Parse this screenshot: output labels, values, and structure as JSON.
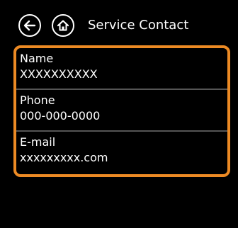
{
  "header": {
    "title": "Service Contact",
    "back_icon": "arrow-left-icon",
    "home_icon": "home-icon"
  },
  "contact": {
    "rows": [
      {
        "label": "Name",
        "value": "XXXXXXXXXX"
      },
      {
        "label": "Phone",
        "value": "000-000-0000"
      },
      {
        "label": "E-mail",
        "value": "xxxxxxxxx.com"
      }
    ]
  },
  "colors": {
    "accent": "#ec8a24",
    "background": "#000000",
    "text": "#ffffff"
  }
}
